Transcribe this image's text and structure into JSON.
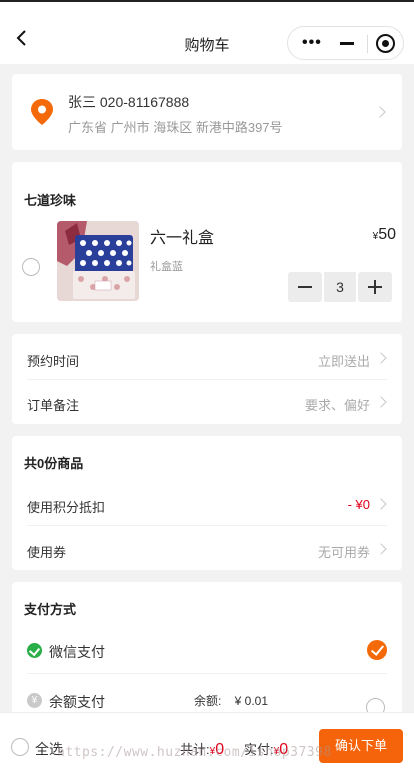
{
  "header": {
    "title": "购物车"
  },
  "address": {
    "name_phone": "张三 020-81167888",
    "detail": "广东省 广州市 海珠区 新港中路397号"
  },
  "shop": {
    "name": "七道珍味",
    "item": {
      "name": "六一礼盒",
      "spec": "礼盒蓝",
      "currency": "¥",
      "price": "50",
      "quantity": "3"
    }
  },
  "options": [
    {
      "label": "预约时间",
      "value": "立即送出"
    },
    {
      "label": "订单备注",
      "value": "要求、偏好"
    }
  ],
  "summary": {
    "heading": "共0份商品",
    "points": {
      "label": "使用积分抵扣",
      "value": "- ¥0"
    },
    "coupon": {
      "label": "使用券",
      "value": "无可用券"
    }
  },
  "payment": {
    "heading": "支付方式",
    "wechat": {
      "label": "微信支付",
      "selected": true
    },
    "balance": {
      "label": "余额支付",
      "icon_text": "¥",
      "balance_text": "余额:    ¥ 0.01",
      "selected": false
    }
  },
  "footer": {
    "select_all": "全选",
    "total_label": "共计:",
    "total_currency": "¥",
    "total_value": "0",
    "paid_label": "实付:",
    "paid_currency": "¥",
    "paid_value": "0",
    "submit": "确认下单"
  },
  "watermark": "https://www.huzhan.com/ishop37398",
  "colors": {
    "accent": "#f5630a",
    "price_red": "#e0001b",
    "wechat_green": "#2aae47"
  }
}
